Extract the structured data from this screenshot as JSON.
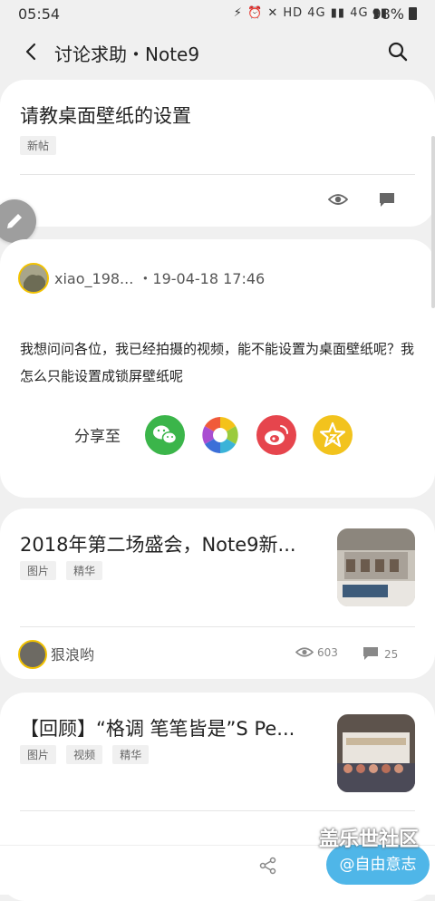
{
  "status_bar": {
    "time": "05:54",
    "indicators": "⚡ ⏰ ✕ HD 4G ▮▮ 4G ▮▮",
    "battery": "98%"
  },
  "app_bar": {
    "title": "讨论求助・Note9"
  },
  "post_header": {
    "title": "请教桌面壁纸的设置",
    "tags": [
      "新帖"
    ]
  },
  "post_body": {
    "author": "xiao_198...",
    "timestamp": "・19-04-18 17:46",
    "text": "我想问问各位，我已经拍摄的视频，能不能设置为桌面壁纸呢？我怎么只能设置成锁屏壁纸呢",
    "share_label": "分享至"
  },
  "feed": [
    {
      "title": "2018年第二场盛会，Note9新...",
      "tags": [
        "图片",
        "精华"
      ],
      "author": "狠浪哟",
      "views": "603",
      "comments": "25"
    },
    {
      "title": "【回顾】“格调 笔笔皆是”S Pe...",
      "tags": [
        "图片",
        "视频",
        "精华"
      ]
    }
  ],
  "bottom": {
    "watermark": "盖乐世社区",
    "free_button": "@自由意志"
  },
  "colors": {
    "wechat": "#3bb54a",
    "weibo": "#e6454d",
    "favorite": "#f2c31d",
    "accent": "#4fb6e8"
  }
}
